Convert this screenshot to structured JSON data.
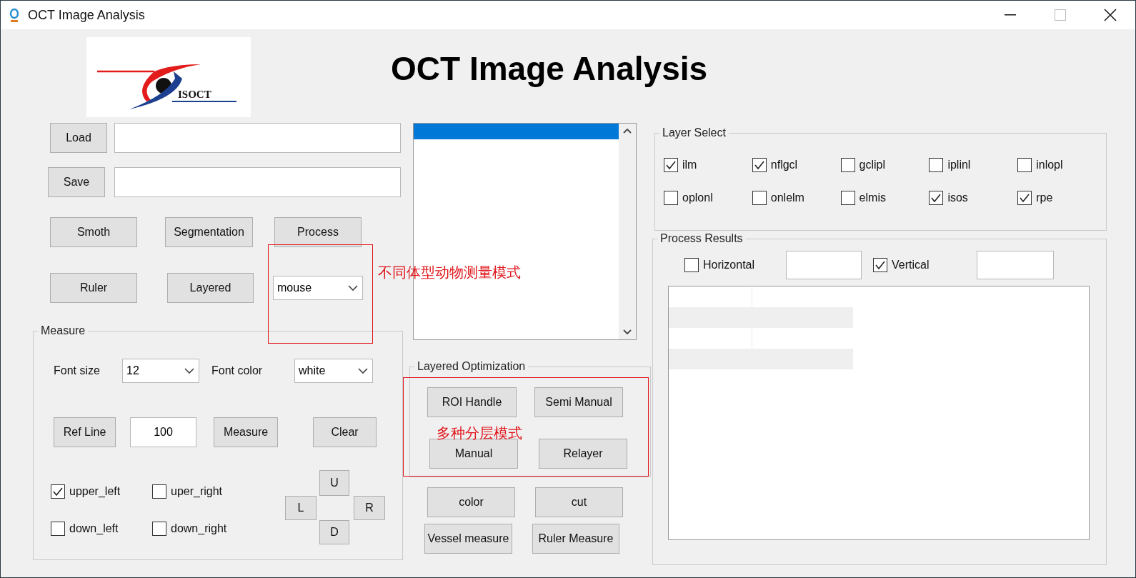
{
  "window": {
    "title": "OCT Image Analysis"
  },
  "logo": {
    "text": "ISOCT"
  },
  "heading": "OCT Image Analysis",
  "file_rows": [
    {
      "button": "Load"
    },
    {
      "button": "Save"
    }
  ],
  "action_buttons": [
    "Smoth",
    "Segmentation",
    "Process",
    "Ruler",
    "Layered"
  ],
  "mode_dropdown": {
    "value": "mouse"
  },
  "listbox": {
    "items": [
      {
        "selected": true
      }
    ]
  },
  "measure": {
    "title": "Measure",
    "font_size": {
      "label": "Font size",
      "value": "12"
    },
    "font_color": {
      "label": "Font color",
      "value": "white"
    },
    "ref_line_button": "Ref Line",
    "ref_value": "100",
    "measure_button": "Measure",
    "clear_button": "Clear",
    "corners": [
      {
        "label": "upper_left",
        "checked": true
      },
      {
        "label": "uper_right",
        "checked": false
      },
      {
        "label": "down_left",
        "checked": false
      },
      {
        "label": "down_right",
        "checked": false
      }
    ],
    "nav": [
      "U",
      "L",
      "R",
      "D"
    ]
  },
  "layered_optimization": {
    "title": "Layered Optimization",
    "buttons": [
      "ROI Handle",
      "Semi Manual",
      "Manual",
      "Relayer"
    ]
  },
  "tools": [
    "color",
    "cut",
    "Vessel measure",
    "Ruler Measure"
  ],
  "layer_select": {
    "title": "Layer Select",
    "layers": [
      {
        "label": "ilm",
        "checked": true
      },
      {
        "label": "nflgcl",
        "checked": true
      },
      {
        "label": "gclipl",
        "checked": false
      },
      {
        "label": "iplinl",
        "checked": false
      },
      {
        "label": "inlopl",
        "checked": false
      },
      {
        "label": "oplonl",
        "checked": false
      },
      {
        "label": "onlelm",
        "checked": false
      },
      {
        "label": "elmis",
        "checked": false
      },
      {
        "label": "isos",
        "checked": true
      },
      {
        "label": "rpe",
        "checked": true
      }
    ]
  },
  "process_results": {
    "title": "Process Results",
    "axes": [
      {
        "label": "Horizontal",
        "checked": false
      },
      {
        "label": "Vertical",
        "checked": true
      }
    ]
  },
  "annotations": [
    {
      "text": "不同体型动物测量模式"
    },
    {
      "text": "多种分层模式"
    }
  ]
}
